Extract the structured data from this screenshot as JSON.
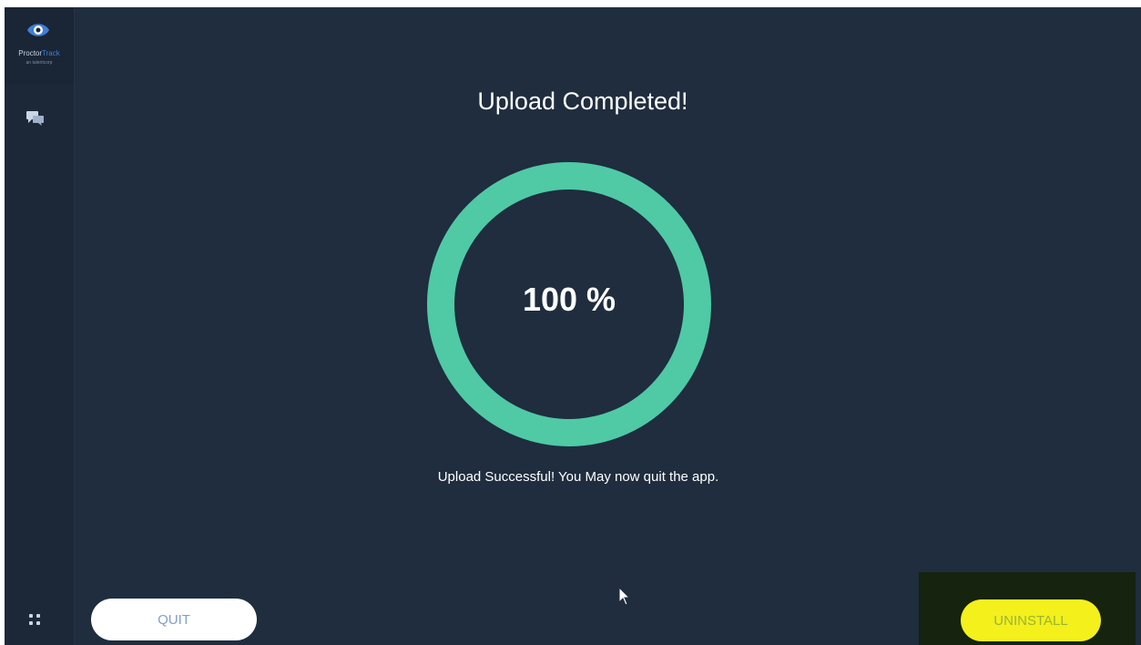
{
  "sidebar": {
    "logo": {
      "brand_main": "Proctor",
      "brand_accent": "Track",
      "tagline": "an talentcorp",
      "icon": "eye-logo-icon"
    },
    "items": [
      {
        "icon": "chat-icon"
      }
    ],
    "footer_icon": "grid-icon"
  },
  "main": {
    "title": "Upload Completed!",
    "progress": {
      "value": 100,
      "label": "100 %"
    },
    "message": "Upload Successful! You May now quit the app."
  },
  "actions": {
    "quit_label": "QUIT",
    "uninstall_label": "UNINSTALL"
  },
  "colors": {
    "background": "#1f2d3e",
    "sidebar": "#1c2838",
    "ring": "#4fcaa5",
    "uninstall_button": "#f4f01c",
    "quit_button": "#ffffff"
  }
}
